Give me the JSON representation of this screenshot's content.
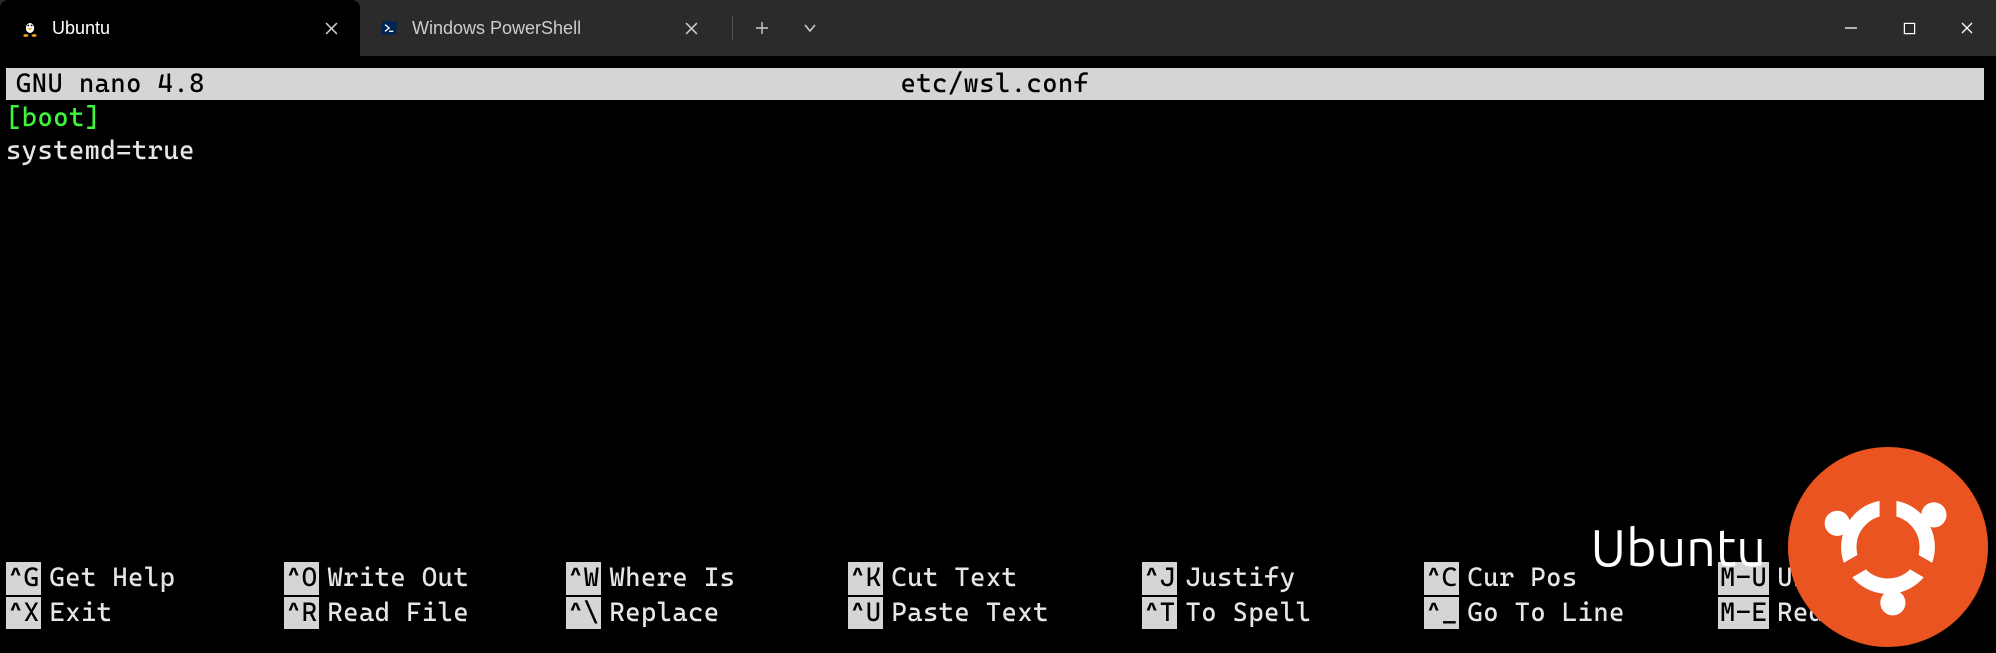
{
  "tabs": [
    {
      "label": "Ubuntu",
      "icon": "tux-icon",
      "active": true
    },
    {
      "label": "Windows PowerShell",
      "icon": "powershell-icon",
      "active": false
    }
  ],
  "nano": {
    "app_name": "GNU nano 4.8",
    "file_path": "etc/wsl.conf",
    "content_lines": [
      {
        "text": "[boot]",
        "class": "green"
      },
      {
        "text": "systemd=true",
        "class": "white"
      }
    ],
    "shortcuts_row1": [
      {
        "key": "^G",
        "desc": "Get Help"
      },
      {
        "key": "^O",
        "desc": "Write Out"
      },
      {
        "key": "^W",
        "desc": "Where Is"
      },
      {
        "key": "^K",
        "desc": "Cut Text"
      },
      {
        "key": "^J",
        "desc": "Justify"
      },
      {
        "key": "^C",
        "desc": "Cur Pos"
      },
      {
        "key": "M-U",
        "desc": "Undo"
      }
    ],
    "shortcuts_row2": [
      {
        "key": "^X",
        "desc": "Exit"
      },
      {
        "key": "^R",
        "desc": "Read File"
      },
      {
        "key": "^\\",
        "desc": "Replace"
      },
      {
        "key": "^U",
        "desc": "Paste Text"
      },
      {
        "key": "^T",
        "desc": "To Spell"
      },
      {
        "key": "^_",
        "desc": "Go To Line"
      },
      {
        "key": "M-E",
        "desc": "Redo"
      }
    ]
  },
  "watermark": {
    "label": "Ubuntu"
  }
}
